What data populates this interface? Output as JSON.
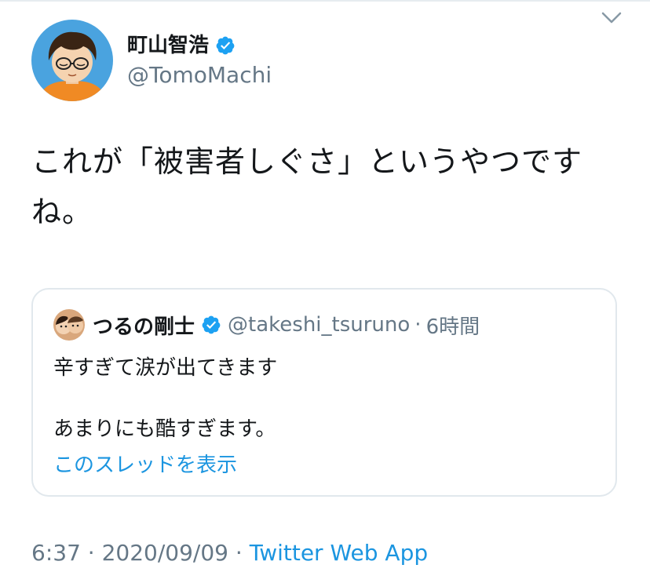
{
  "author": {
    "name": "町山智浩",
    "handle": "@TomoMachi",
    "verified": true
  },
  "tweet": {
    "text": "これが「被害者しぐさ」というやつですね。"
  },
  "quoted_tweet": {
    "author_name": "つるの剛士",
    "author_handle": "@takeshi_tsuruno",
    "separator": "·",
    "time_ago": "6時間",
    "line1": "辛すぎて涙が出てきます",
    "line2": "あまりにも酷すぎます。",
    "show_thread_label": "このスレッドを表示"
  },
  "meta": {
    "time": "6:37",
    "separator": "·",
    "date": "2020/09/09",
    "source": "Twitter Web App"
  },
  "colors": {
    "accent": "#1b95e0",
    "verified": "#1da1f2",
    "secondary_text": "#657786",
    "primary_text": "#14171a",
    "border": "#e1e8ed"
  },
  "icons": {
    "caret": "chevron-down-icon",
    "verified": "verified-badge-icon"
  }
}
